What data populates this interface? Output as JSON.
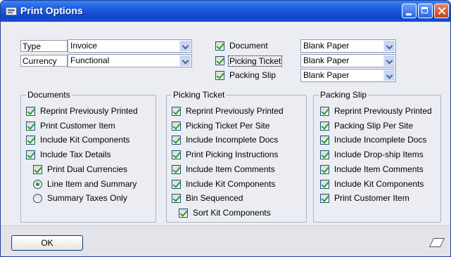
{
  "window": {
    "title": "Print Options"
  },
  "top_left": {
    "type_label": "Type",
    "type_value": "Invoice",
    "currency_label": "Currency",
    "currency_value": "Functional"
  },
  "top_right": {
    "rows": [
      {
        "label": "Document",
        "checked": true,
        "value": "Blank Paper"
      },
      {
        "label": "Picking Ticket",
        "checked": true,
        "value": "Blank Paper"
      },
      {
        "label": "Packing Slip",
        "checked": true,
        "value": "Blank Paper"
      }
    ]
  },
  "documents": {
    "title": "Documents",
    "items": [
      {
        "label": "Reprint Previously Printed",
        "checked": true
      },
      {
        "label": "Print Customer Item",
        "checked": true
      },
      {
        "label": "Include Kit Components",
        "checked": true
      },
      {
        "label": "Include Tax Details",
        "checked": true
      },
      {
        "label": "Print Dual Currencies",
        "checked": true
      }
    ],
    "radios": [
      {
        "label": "Line Item and Summary",
        "selected": true
      },
      {
        "label": "Summary Taxes Only",
        "selected": false
      }
    ]
  },
  "picking_ticket": {
    "title": "Picking Ticket",
    "items": [
      {
        "label": "Reprint Previously Printed",
        "checked": true
      },
      {
        "label": "Picking Ticket Per Site",
        "checked": true
      },
      {
        "label": "Include Incomplete Docs",
        "checked": true
      },
      {
        "label": "Print Picking Instructions",
        "checked": true
      },
      {
        "label": "Include Item Comments",
        "checked": true
      },
      {
        "label": "Include Kit Components",
        "checked": true
      },
      {
        "label": "Bin Sequenced",
        "checked": true
      },
      {
        "label": "Sort Kit Components",
        "checked": true
      }
    ]
  },
  "packing_slip": {
    "title": "Packing Slip",
    "items": [
      {
        "label": "Reprint Previously Printed",
        "checked": true
      },
      {
        "label": "Packing Slip Per Site",
        "checked": true
      },
      {
        "label": "Include Incomplete Docs",
        "checked": true
      },
      {
        "label": "Include Drop-ship Items",
        "checked": true
      },
      {
        "label": "Include Item Comments",
        "checked": true
      },
      {
        "label": "Include Kit Components",
        "checked": true
      },
      {
        "label": "Print Customer Item",
        "checked": true
      }
    ]
  },
  "footer": {
    "ok_label": "OK"
  }
}
